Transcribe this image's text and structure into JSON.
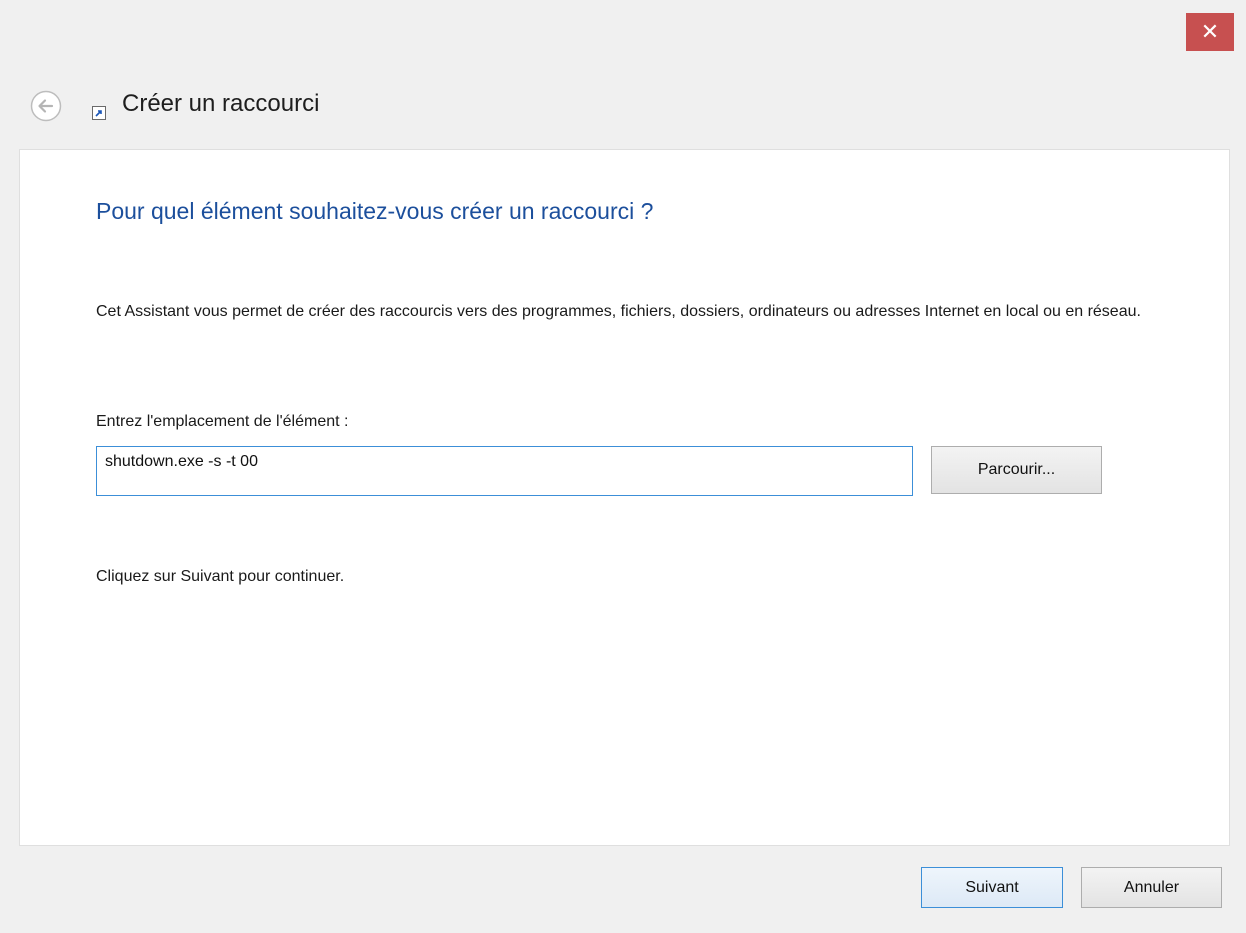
{
  "window": {
    "title": "Créer un raccourci",
    "close_label": "✕"
  },
  "page": {
    "heading": "Pour quel élément souhaitez-vous créer un raccourci ?",
    "description": "Cet Assistant vous permet de créer des raccourcis vers des programmes, fichiers, dossiers, ordinateurs ou adresses Internet en local ou en réseau.",
    "location_label": "Entrez l'emplacement de l'élément :",
    "location_value": "shutdown.exe -s -t 00",
    "browse_label": "Parcourir...",
    "continue_hint": "Cliquez sur Suivant pour continuer."
  },
  "footer": {
    "next_label": "Suivant",
    "cancel_label": "Annuler"
  },
  "icons": {
    "back": "back-arrow-icon",
    "title": "shortcut-icon",
    "close": "close-icon"
  },
  "colors": {
    "heading": "#1c4f9c",
    "close_button": "#c75050",
    "focus_border": "#3c8fd8"
  }
}
